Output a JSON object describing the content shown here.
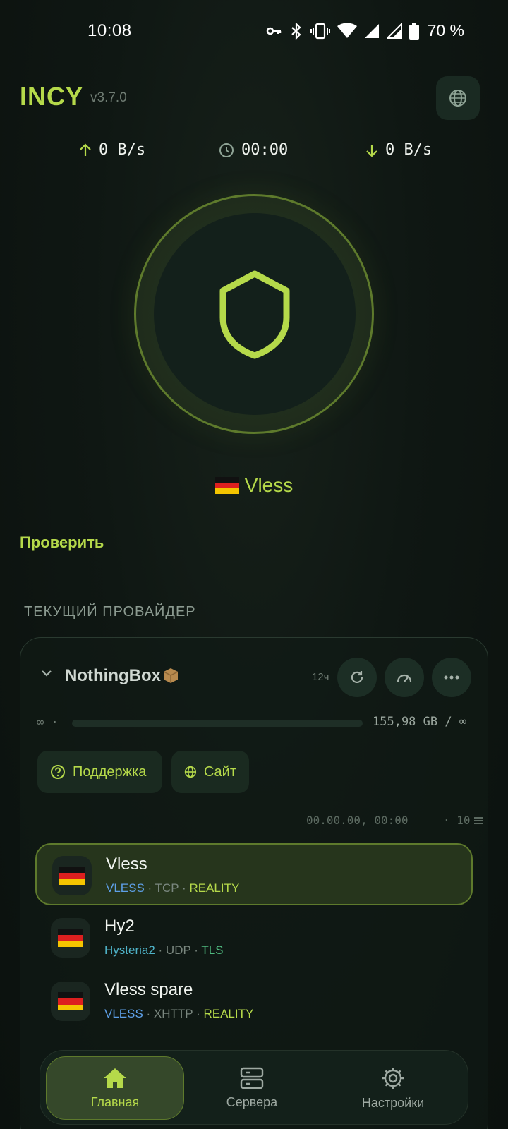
{
  "status_bar": {
    "time": "10:08",
    "battery": "70 %"
  },
  "header": {
    "title": "INCY",
    "version": "v3.7.0"
  },
  "stats": {
    "upload": "0 B/s",
    "timer": "00:00",
    "download": "0 B/s"
  },
  "current_server": {
    "name": "Vless",
    "flag": "germany-flag"
  },
  "check_label": "Проверить",
  "section_label": "ТЕКУЩИЙ ПРОВАЙДЕР",
  "provider": {
    "name": "NothingBox",
    "age": "12ч",
    "usage_left": "∞ ·",
    "usage_text": "155,98 GB / ∞",
    "support_label": "Поддержка",
    "site_label": "Сайт",
    "updated": "00.00.00, 00:00",
    "count": "· 10"
  },
  "servers": [
    {
      "name": "Vless",
      "protocol": "VLESS",
      "transport": "TCP",
      "security": "REALITY",
      "active": true
    },
    {
      "name": "Hy2",
      "protocol": "Hysteria2",
      "transport": "UDP",
      "security": "TLS",
      "active": false
    },
    {
      "name": "Vless spare",
      "protocol": "VLESS",
      "transport": "XHTTP",
      "security": "REALITY",
      "active": false
    }
  ],
  "nav": {
    "home": "Главная",
    "servers": "Сервера",
    "settings": "Настройки"
  },
  "colors": {
    "accent": "#b5d94a",
    "background": "#0f1713",
    "vless": "#5ea0e8",
    "tls": "#4fb97f"
  }
}
